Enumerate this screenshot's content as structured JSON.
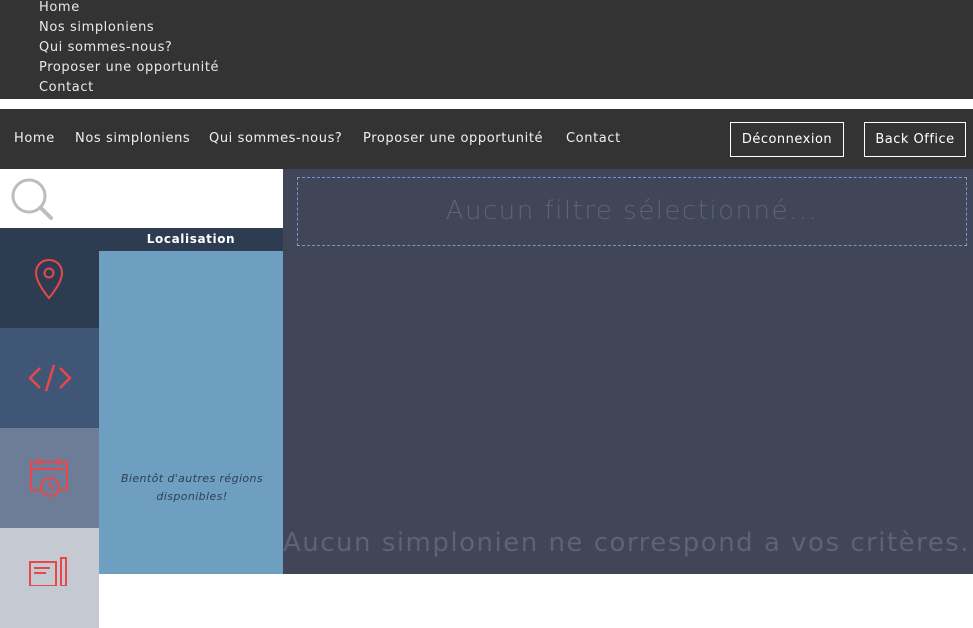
{
  "top_menu": {
    "items": [
      "Home",
      "Nos simploniens",
      "Qui sommes-nous?",
      "Proposer une opportunité",
      "Contact"
    ]
  },
  "navbar": {
    "items": [
      "Home",
      "Nos simploniens",
      "Qui sommes-nous?",
      "Proposer une opportunité",
      "Contact"
    ],
    "logout_label": "Déconnexion",
    "backoffice_label": "Back Office"
  },
  "search": {
    "icon": "search-icon"
  },
  "filters": {
    "tabs": [
      {
        "id": "location",
        "icon": "map-pin-icon",
        "color": "#2e3c52"
      },
      {
        "id": "skills",
        "icon": "code-icon",
        "color": "#3f5676"
      },
      {
        "id": "availability",
        "icon": "calendar-clock-icon",
        "color": "#6d7d97"
      },
      {
        "id": "contract",
        "icon": "document-icon",
        "color": "#c4c9d2"
      }
    ],
    "active_tab": "location",
    "panel_title": "Localisation",
    "panel_note": "Bientôt d'autres régions disponibles!"
  },
  "results": {
    "filter_placeholder": "Aucun filtre sélectionné...",
    "empty_message": "Aucun simplonien ne correspond a vos critères..."
  },
  "colors": {
    "nav_bg": "#333333",
    "results_bg": "#414558",
    "panel_bg": "#6e9fc0",
    "accent_red": "#e8484a"
  }
}
